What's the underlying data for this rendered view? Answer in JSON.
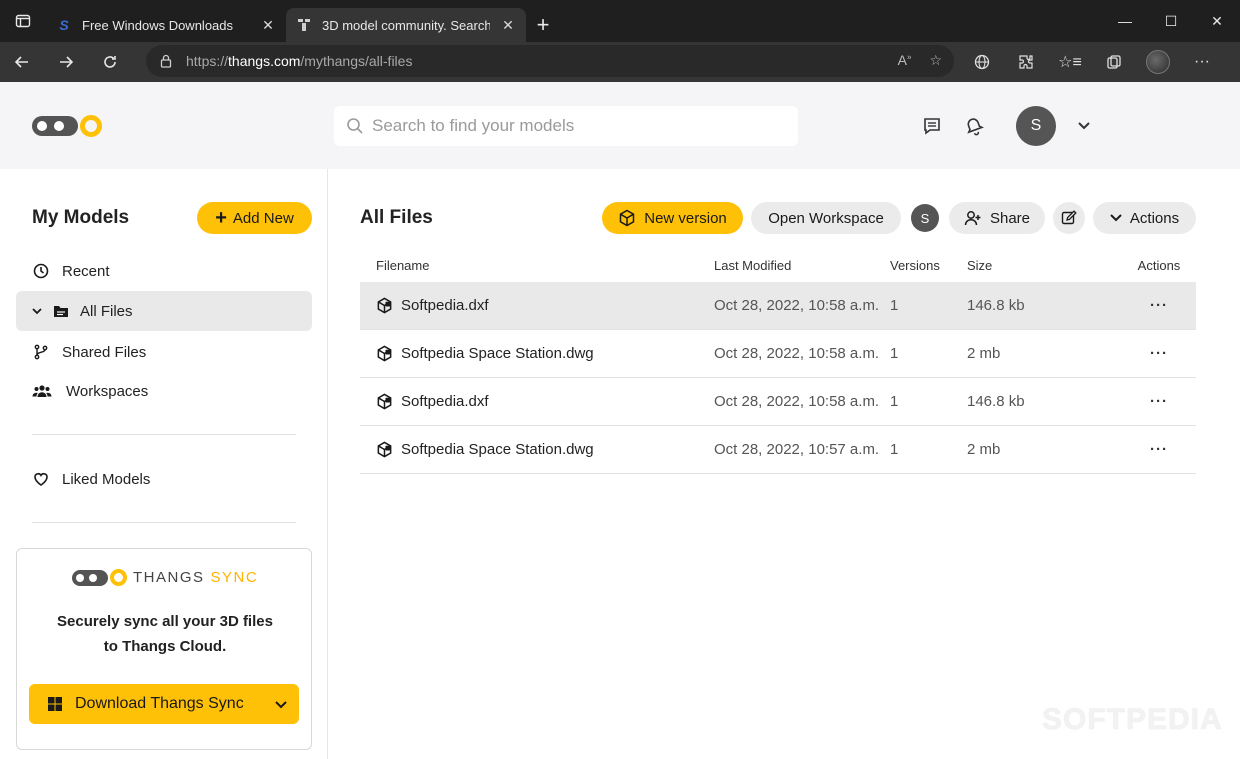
{
  "browser": {
    "tabs": [
      {
        "title": "Free Windows Downloads",
        "favicon": "softpedia-s-icon"
      },
      {
        "title": "3D model community. Search &",
        "favicon": "thangs-icon"
      }
    ],
    "url_prefix": "https://",
    "url_host": "thangs.com",
    "url_path": "/mythangs/all-files"
  },
  "header": {
    "search_placeholder": "Search to find your models",
    "user_initial": "S"
  },
  "sidebar": {
    "title": "My Models",
    "add_new": "Add New",
    "items": [
      {
        "label": "Recent"
      },
      {
        "label": "All Files"
      },
      {
        "label": "Shared Files"
      },
      {
        "label": "Workspaces"
      },
      {
        "label": "Liked Models"
      }
    ],
    "sync": {
      "brand_1": "THANGS",
      "brand_2": "SYNC",
      "line1": "Securely sync all your 3D files",
      "line2": "to Thangs Cloud.",
      "button": "Download Thangs Sync"
    }
  },
  "main": {
    "title": "All Files",
    "buttons": {
      "new_version": "New version",
      "open_workspace": "Open Workspace",
      "member_initial": "S",
      "share": "Share",
      "actions": "Actions"
    },
    "columns": [
      "Filename",
      "Last Modified",
      "Versions",
      "Size",
      "Actions"
    ],
    "rows": [
      {
        "name": "Softpedia.dxf",
        "modified": "Oct 28, 2022, 10:58 a.m.",
        "versions": "1",
        "size": "146.8 kb"
      },
      {
        "name": "Softpedia Space Station.dwg",
        "modified": "Oct 28, 2022, 10:58 a.m.",
        "versions": "1",
        "size": "2 mb"
      },
      {
        "name": "Softpedia.dxf",
        "modified": "Oct 28, 2022, 10:58 a.m.",
        "versions": "1",
        "size": "146.8 kb"
      },
      {
        "name": "Softpedia Space Station.dwg",
        "modified": "Oct 28, 2022, 10:57 a.m.",
        "versions": "1",
        "size": "2 mb"
      }
    ],
    "row_actions": "···"
  },
  "watermark": "SOFTPEDIA",
  "colors": {
    "accent": "#ffc107",
    "chrome_dark": "#1f1f1f",
    "header_bg": "#f5f5f7"
  }
}
